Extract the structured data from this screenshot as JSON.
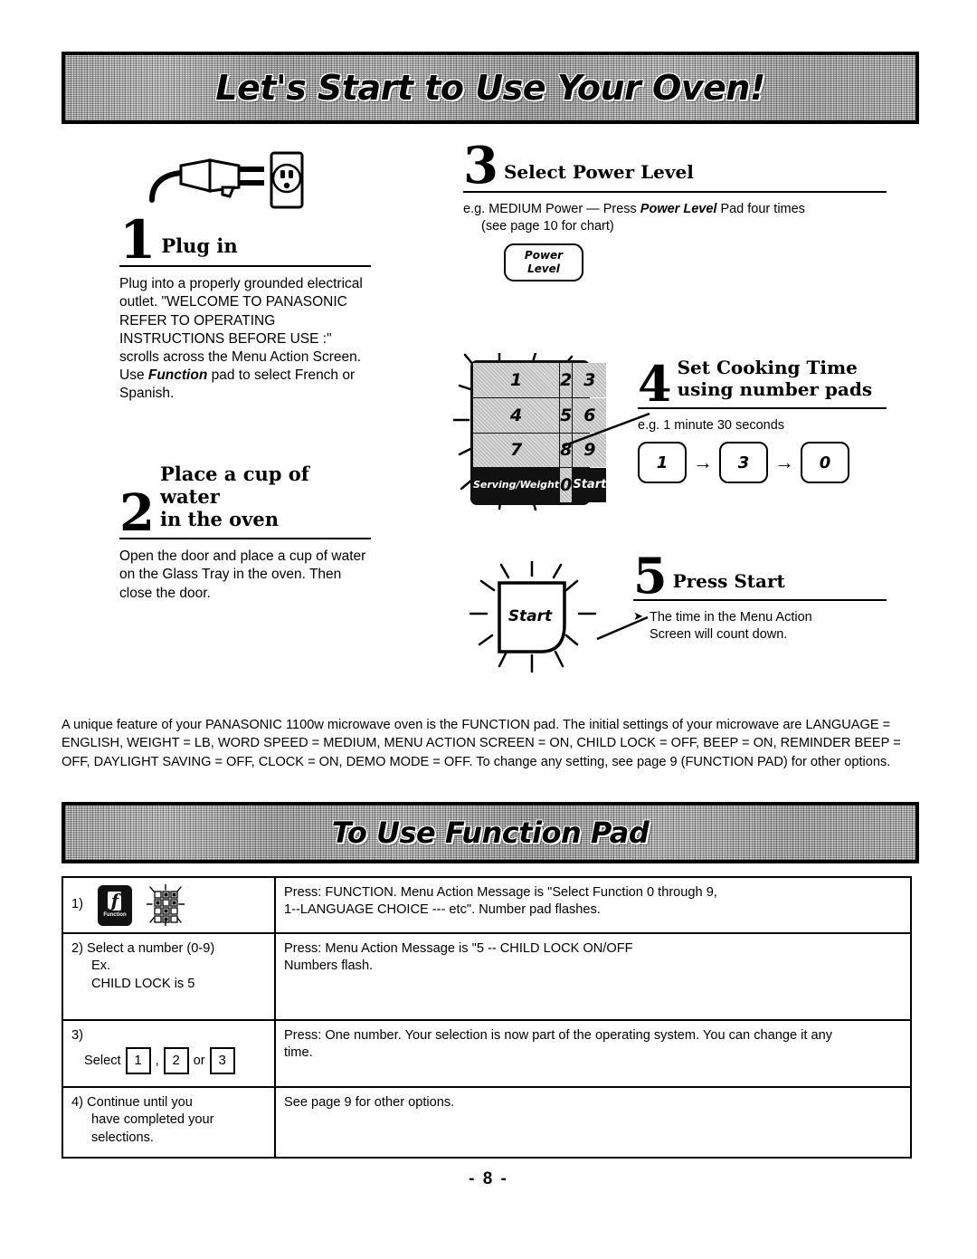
{
  "banners": {
    "top": "Let's Start to Use Your Oven!",
    "bottom": "To Use Function Pad"
  },
  "steps": [
    {
      "number": "1",
      "title": "Plug in",
      "body": "Plug into a properly grounded electrical outlet. \"WELCOME TO PANASONIC  REFER TO OPERATING INSTRUCTIONS BEFORE USE    :\" scrolls across the Menu Action Screen. Use ",
      "body_emphasis": "Function",
      "body_tail": " pad to select French or Spanish."
    },
    {
      "number": "2",
      "title_line1": "Place a cup of water",
      "title_line2": "in the oven",
      "body": "Open the door and place a cup of water on the Glass Tray in the oven. Then close the door."
    },
    {
      "number": "3",
      "title": "Select Power Level",
      "body_pre": "e.g. MEDIUM Power — Press ",
      "body_emphasis": "Power Level",
      "body_post": " Pad four times",
      "body_line2": "(see page 10 for chart)",
      "button_line1": "Power",
      "button_line2": "Level"
    },
    {
      "number": "4",
      "title_line1": "Set Cooking Time",
      "title_line2": "using number pads",
      "body": "e.g. 1 minute 30 seconds",
      "sequence": [
        "1",
        "3",
        "0"
      ],
      "sequence_arrow": "→"
    },
    {
      "number": "5",
      "title": "Press Start",
      "bullet": "➤",
      "body_line1": "The time in the Menu Action",
      "body_line2": "Screen will count down."
    }
  ],
  "keypad": {
    "keys": [
      "1",
      "2",
      "3",
      "4",
      "5",
      "6",
      "7",
      "8",
      "9"
    ],
    "serving_weight_line1": "Serving/",
    "serving_weight_line2": "Weight",
    "zero": "0",
    "start": "Start"
  },
  "start_button": {
    "label": "Start"
  },
  "feature_paragraph": "A unique feature of your PANASONIC 1100w microwave oven is the FUNCTION pad. The initial settings of your microwave are LANGUAGE = ENGLISH, WEIGHT = LB, WORD SPEED = MEDIUM, MENU ACTION SCREEN = ON, CHILD LOCK = OFF, BEEP = ON, REMINDER BEEP = OFF, DAYLIGHT SAVING = OFF, CLOCK = ON, DEMO MODE = OFF. To change any setting, see page 9 (FUNCTION PAD) for other options.",
  "function_table": {
    "rows": [
      {
        "marker": "1)",
        "left_has_icon": true,
        "function_pad_label": "Function",
        "function_pad_glyph": "ƒ",
        "right_line1": "Press: FUNCTION. Menu Action Message is \"Select Function 0 through 9,",
        "right_line2": "1--LANGUAGE CHOICE --- etc\". Number pad flashes."
      },
      {
        "marker": "2)",
        "left_line1": "Select a number (0-9)",
        "left_line2": "Ex.",
        "left_line3": "CHILD LOCK is 5",
        "right_line1": "Press: Menu Action Message is \"5 -- CHILD LOCK ON/OFF",
        "right_line2": "Numbers flash."
      },
      {
        "marker": "3)",
        "select_label": "Select",
        "select_boxes": [
          "1",
          "2",
          "3"
        ],
        "select_sep": ",",
        "select_or": "or",
        "right_line1": "Press: One number. Your selection is now part of the operating system. You can change it any",
        "right_line2": "time."
      },
      {
        "marker": "4)",
        "left_line1": "Continue until you",
        "left_line2": "have completed your",
        "left_line3": "selections.",
        "right_line1": "See page 9 for other options."
      }
    ]
  },
  "footer": {
    "page_number": "- 8 -"
  }
}
